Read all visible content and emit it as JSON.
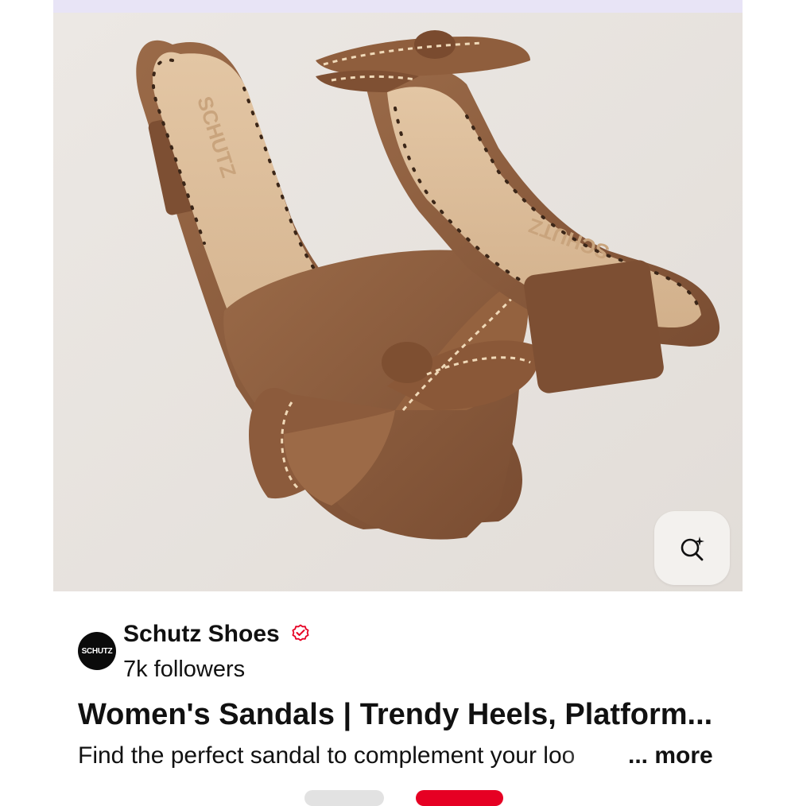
{
  "pin": {
    "image_alt": "Brown leather block-heel sandals with bow detail",
    "insole_brand": "SCHUTZ",
    "visual_search_icon": "visual-search-sparkle-icon"
  },
  "creator": {
    "avatar_text": "SCHUTZ",
    "name": "Schutz Shoes",
    "verified_icon": "verified-badge-icon",
    "followers": "7k followers"
  },
  "title": "Women's Sandals | Trendy Heels, Platform...",
  "description": "Find the perfect sandal to complement your loo",
  "more_label": "... more",
  "colors": {
    "accent": "#e60023",
    "verified": "#e60023",
    "leather": "#8a5a3c",
    "insole": "#d8b896"
  }
}
